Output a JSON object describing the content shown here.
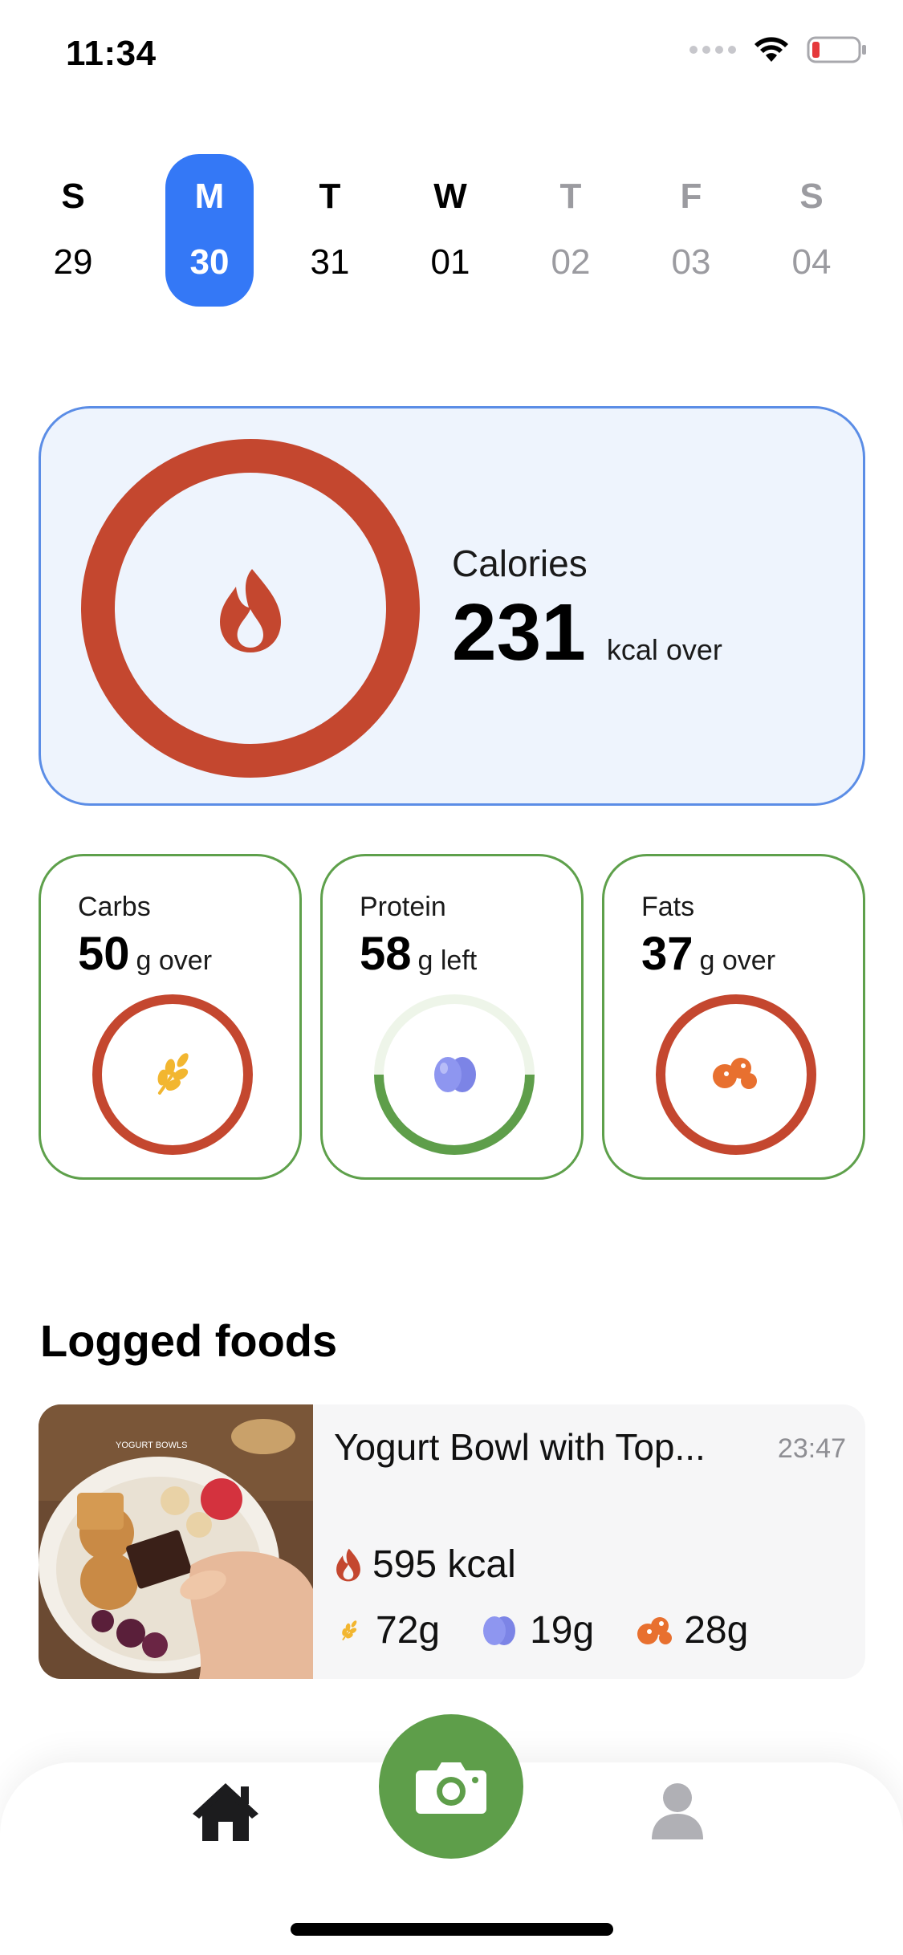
{
  "status_bar": {
    "time": "11:34"
  },
  "week": [
    {
      "letter": "S",
      "number": "29",
      "state": "past"
    },
    {
      "letter": "M",
      "number": "30",
      "state": "selected"
    },
    {
      "letter": "T",
      "number": "31",
      "state": "past"
    },
    {
      "letter": "W",
      "number": "01",
      "state": "today"
    },
    {
      "letter": "T",
      "number": "02",
      "state": "future"
    },
    {
      "letter": "F",
      "number": "03",
      "state": "future"
    },
    {
      "letter": "S",
      "number": "04",
      "state": "future"
    }
  ],
  "calories": {
    "label": "Calories",
    "value": "231",
    "unit": "kcal over",
    "icon": "flame-icon",
    "ring_color": "#c4472f"
  },
  "macros": [
    {
      "label": "Carbs",
      "value": "50",
      "unit": "g over",
      "icon": "wheat-icon",
      "icon_color": "#f2b630",
      "ring_color": "#c4472f",
      "progress": 1.0
    },
    {
      "label": "Protein",
      "value": "58",
      "unit": "g left",
      "icon": "eggs-icon",
      "icon_color": "#8e96f0",
      "ring_color": "#5e9e4a",
      "progress": 0.5
    },
    {
      "label": "Fats",
      "value": "37",
      "unit": "g over",
      "icon": "fat-drops-icon",
      "icon_color": "#e8702f",
      "ring_color": "#c4472f",
      "progress": 1.0
    }
  ],
  "logged_foods": {
    "title": "Logged foods",
    "items": [
      {
        "name": "Yogurt Bowl with Top...",
        "time": "23:47",
        "kcal": "595 kcal",
        "carbs": "72g",
        "protein": "19g",
        "fats": "28g",
        "photo_caption": "YOGURT BOWLS"
      }
    ]
  },
  "tab_bar": {
    "items": [
      "home-icon",
      "camera-icon",
      "profile-icon"
    ],
    "camera_color": "#5e9e4a"
  },
  "colors": {
    "accent": "#3478f6",
    "over": "#c4472f",
    "ok": "#5e9e4a",
    "card_border": "#5ea04b"
  }
}
